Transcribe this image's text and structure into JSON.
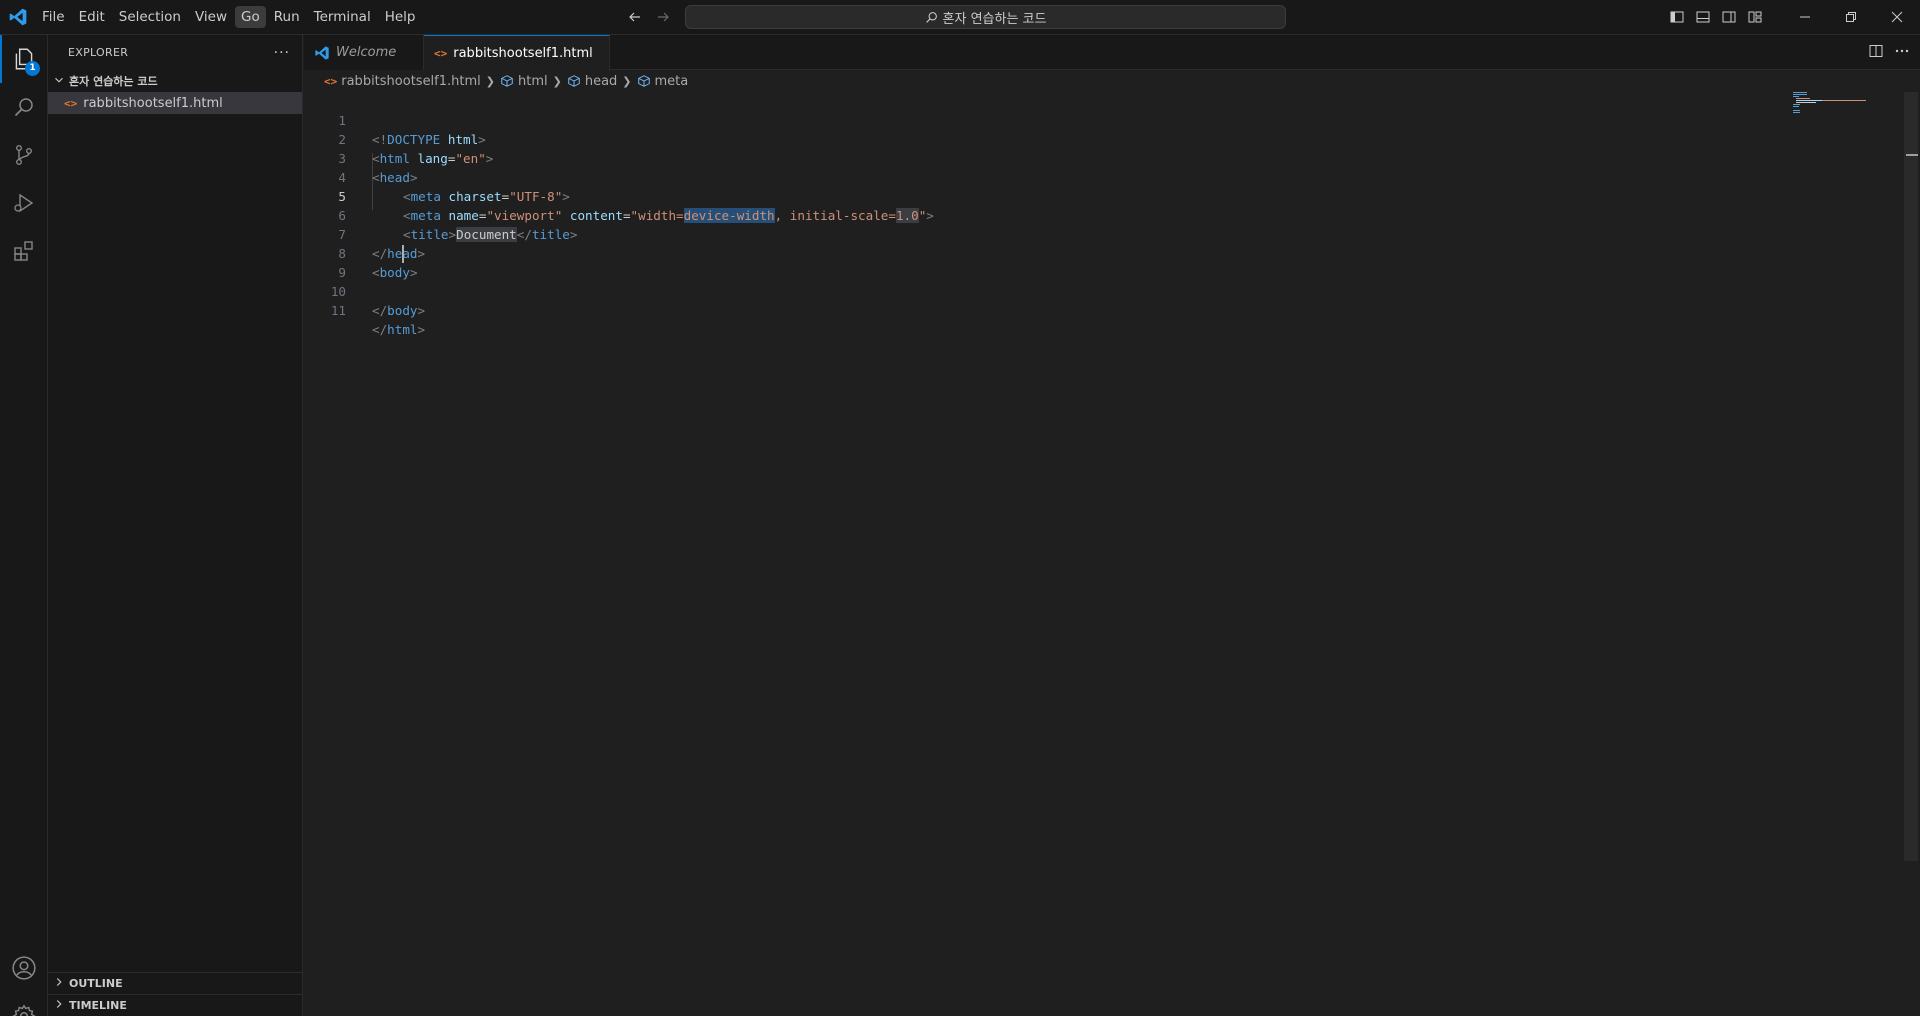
{
  "menu": [
    "File",
    "Edit",
    "Selection",
    "View",
    "Go",
    "Run",
    "Terminal",
    "Help"
  ],
  "search": {
    "text": "혼자 연습하는 코드"
  },
  "explorer": {
    "title": "EXPLORER",
    "more": "···",
    "folder": "혼자 연습하는 코드",
    "file": "rabbitshootself1.html",
    "outline": "OUTLINE",
    "timeline": "TIMELINE",
    "badge": "1"
  },
  "tabs": {
    "welcome": "Welcome",
    "active": "rabbitshootself1.html"
  },
  "breadcrumb": {
    "file": "rabbitshootself1.html",
    "html": "html",
    "head": "head",
    "meta": "meta"
  },
  "editor": {
    "line_numbers": [
      "1",
      "2",
      "3",
      "4",
      "5",
      "6",
      "7",
      "8",
      "9",
      "10",
      "11"
    ],
    "current_line": 5,
    "lines": {
      "l1": {
        "a": "<!",
        "b": "DOCTYPE",
        "c": " html",
        "d": ">"
      },
      "l2": {
        "a": "<",
        "b": "html",
        "c": " lang",
        "d": "=",
        "e": "\"en\"",
        "f": ">"
      },
      "l3": {
        "a": "<",
        "b": "head",
        "c": ">"
      },
      "l4": {
        "a": "<",
        "b": "meta",
        "c": " charset",
        "d": "=",
        "e": "\"UTF-8\"",
        "f": ">"
      },
      "l5": {
        "a": "<",
        "b": "meta",
        "c": " name",
        "d": "=",
        "e": "\"viewport\"",
        "f": " content",
        "g": "=",
        "h1": "\"width=",
        "h2": "device-width",
        "h3": ", initial-scale=",
        "h4": "1.0",
        "h5": "\"",
        "i": ">"
      },
      "l6": {
        "a": "<",
        "b": "title",
        "c": ">",
        "d": "Document",
        "e": "</",
        "f": "title",
        "g": ">"
      },
      "l7": {
        "a": "</",
        "b": "head",
        "c": ">"
      },
      "l8": {
        "a": "<",
        "b": "body",
        "c": ">"
      },
      "l10": {
        "a": "</",
        "b": "body",
        "c": ">"
      },
      "l11": {
        "a": "</",
        "b": "html",
        "c": ">"
      }
    }
  },
  "colors": {
    "accent": "#0078d4",
    "tag": "#569cd6",
    "attribute": "#9cdcfe",
    "string": "#ce9178",
    "html_file_icon": "#e37933",
    "selection": "#264f78"
  },
  "icons": {
    "title": "vscode-logo-icon",
    "activity": [
      "explorer-icon",
      "search-icon",
      "source-control-icon",
      "run-debug-icon",
      "extensions-icon",
      "account-icon",
      "settings-gear-icon"
    ]
  }
}
